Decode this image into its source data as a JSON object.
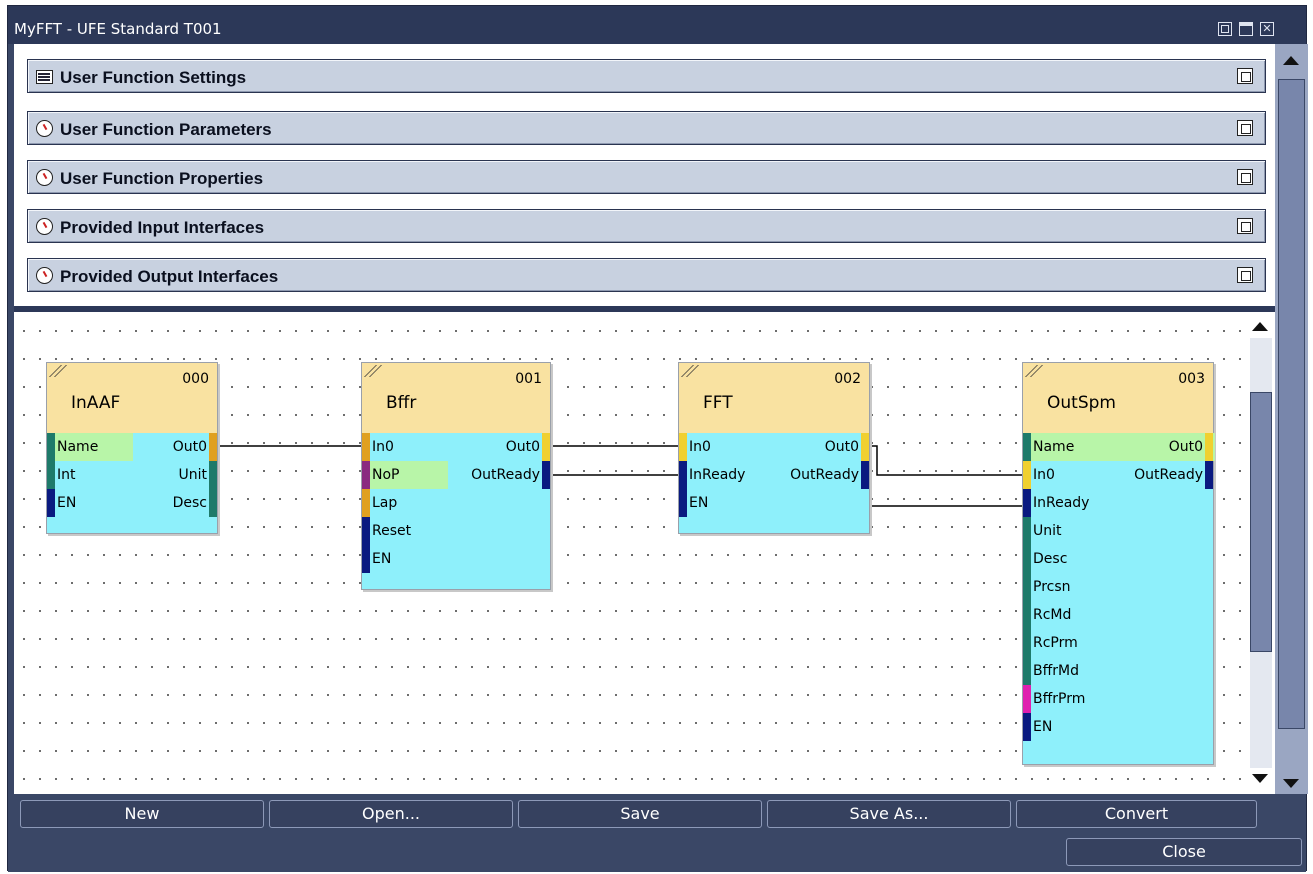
{
  "window": {
    "title": "MyFFT - UFE Standard T001"
  },
  "sections": [
    {
      "label": "User Function Settings",
      "icon": "list-icon"
    },
    {
      "label": "User Function Parameters",
      "icon": "clock-icon"
    },
    {
      "label": "User Function Properties",
      "icon": "clock-icon"
    },
    {
      "label": "Provided Input Interfaces",
      "icon": "clock-icon"
    },
    {
      "label": "Provided Output Interfaces",
      "icon": "clock-icon"
    }
  ],
  "blocks": [
    {
      "num": "000",
      "name": "InAAF",
      "inputs": [
        "Name",
        "Int",
        "EN"
      ],
      "outputs": [
        "Out0",
        "Unit",
        "Desc"
      ]
    },
    {
      "num": "001",
      "name": "Bffr",
      "inputs": [
        "In0",
        "NoP",
        "Lap",
        "Reset",
        "EN"
      ],
      "outputs": [
        "Out0",
        "OutReady"
      ]
    },
    {
      "num": "002",
      "name": "FFT",
      "inputs": [
        "In0",
        "InReady",
        "EN"
      ],
      "outputs": [
        "Out0",
        "OutReady"
      ]
    },
    {
      "num": "003",
      "name": "OutSpm",
      "inputs": [
        "Name",
        "In0",
        "InReady",
        "Unit",
        "Desc",
        "Prcsn",
        "RcMd",
        "RcPrm",
        "BffrMd",
        "BffrPrm",
        "EN"
      ],
      "outputs": [
        "Out0",
        "OutReady"
      ]
    }
  ],
  "colors": {
    "port_teal": "#1e7a6a",
    "port_orange": "#e0a020",
    "port_navy": "#0a1a80",
    "port_purple": "#8a2a80",
    "port_magenta": "#e020b0",
    "port_yellow": "#f0d030",
    "block_body": "#8ef0fb",
    "block_head": "#f9e2a1",
    "highlight": "#b8f5a8"
  },
  "buttons": {
    "new": "New",
    "open": "Open...",
    "save": "Save",
    "save_as": "Save As...",
    "convert": "Convert",
    "close": "Close"
  }
}
